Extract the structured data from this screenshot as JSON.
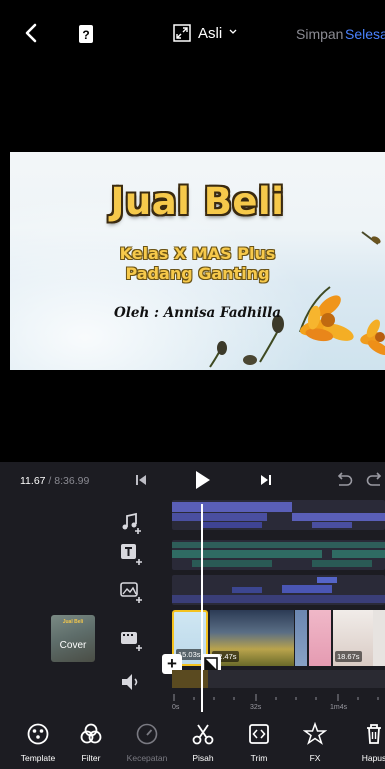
{
  "topbar": {
    "aspect_label": "Asli",
    "save_label": "Simpan",
    "done_label": "Selesai"
  },
  "preview": {
    "title": "Jual Beli",
    "subtitle_line1": "Kelas X MAS Plus",
    "subtitle_line2": "Padang Ganting",
    "byline": "Oleh : Annisa Fadhilla"
  },
  "player": {
    "current_time": "11.67",
    "total_time": "/ 8:36.99"
  },
  "timeline": {
    "cover_label": "Cover",
    "cover_title": "Jual Beli",
    "clips": [
      {
        "duration": "15.03s"
      },
      {
        "duration": "32.47s"
      },
      {
        "duration": "18.67s"
      }
    ],
    "ruler_labels": [
      "0s",
      "32s",
      "1m4s"
    ]
  },
  "toolbar": {
    "items": [
      {
        "label": "Template",
        "icon": "template-icon",
        "enabled": true
      },
      {
        "label": "Filter",
        "icon": "filter-icon",
        "enabled": true
      },
      {
        "label": "Kecepatan",
        "icon": "speed-icon",
        "enabled": false
      },
      {
        "label": "Pisah",
        "icon": "scissors-icon",
        "enabled": true
      },
      {
        "label": "Trim",
        "icon": "trim-icon",
        "enabled": true
      },
      {
        "label": "FX",
        "icon": "fx-icon",
        "enabled": true
      },
      {
        "label": "Hapus",
        "icon": "trash-icon",
        "enabled": true
      }
    ]
  },
  "colors": {
    "accent": "#4a82ff",
    "selection": "#f4c21f",
    "panel": "#1c1c22",
    "title_yellow": "#f6c94b"
  }
}
